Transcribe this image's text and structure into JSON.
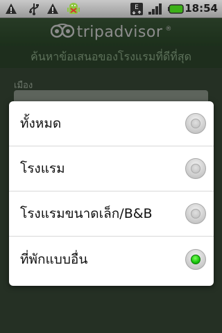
{
  "status_bar": {
    "time": "18:54",
    "icons": [
      "warning-icon",
      "usb-icon",
      "warning-icon",
      "android-bug-icon",
      "edge-network-icon",
      "signal-icon",
      "battery-icon"
    ]
  },
  "app": {
    "logo_text": "tripadvisor",
    "logo_mark": "®",
    "subtitle": "ค้นหาข้อเสนอของโรงแรมที่ดีที่สุด",
    "city_label": "เมือง"
  },
  "dialog": {
    "options": [
      {
        "label": "ทั้งหมด",
        "checked": false
      },
      {
        "label": "โรงแรม",
        "checked": false
      },
      {
        "label": "โรงแรมขนาดเล็ก/B&B",
        "checked": false
      },
      {
        "label": "ที่พักแบบอื่น",
        "checked": true
      }
    ]
  },
  "colors": {
    "accent_green": "#17c40b",
    "header_green": "#2c4a2a"
  }
}
